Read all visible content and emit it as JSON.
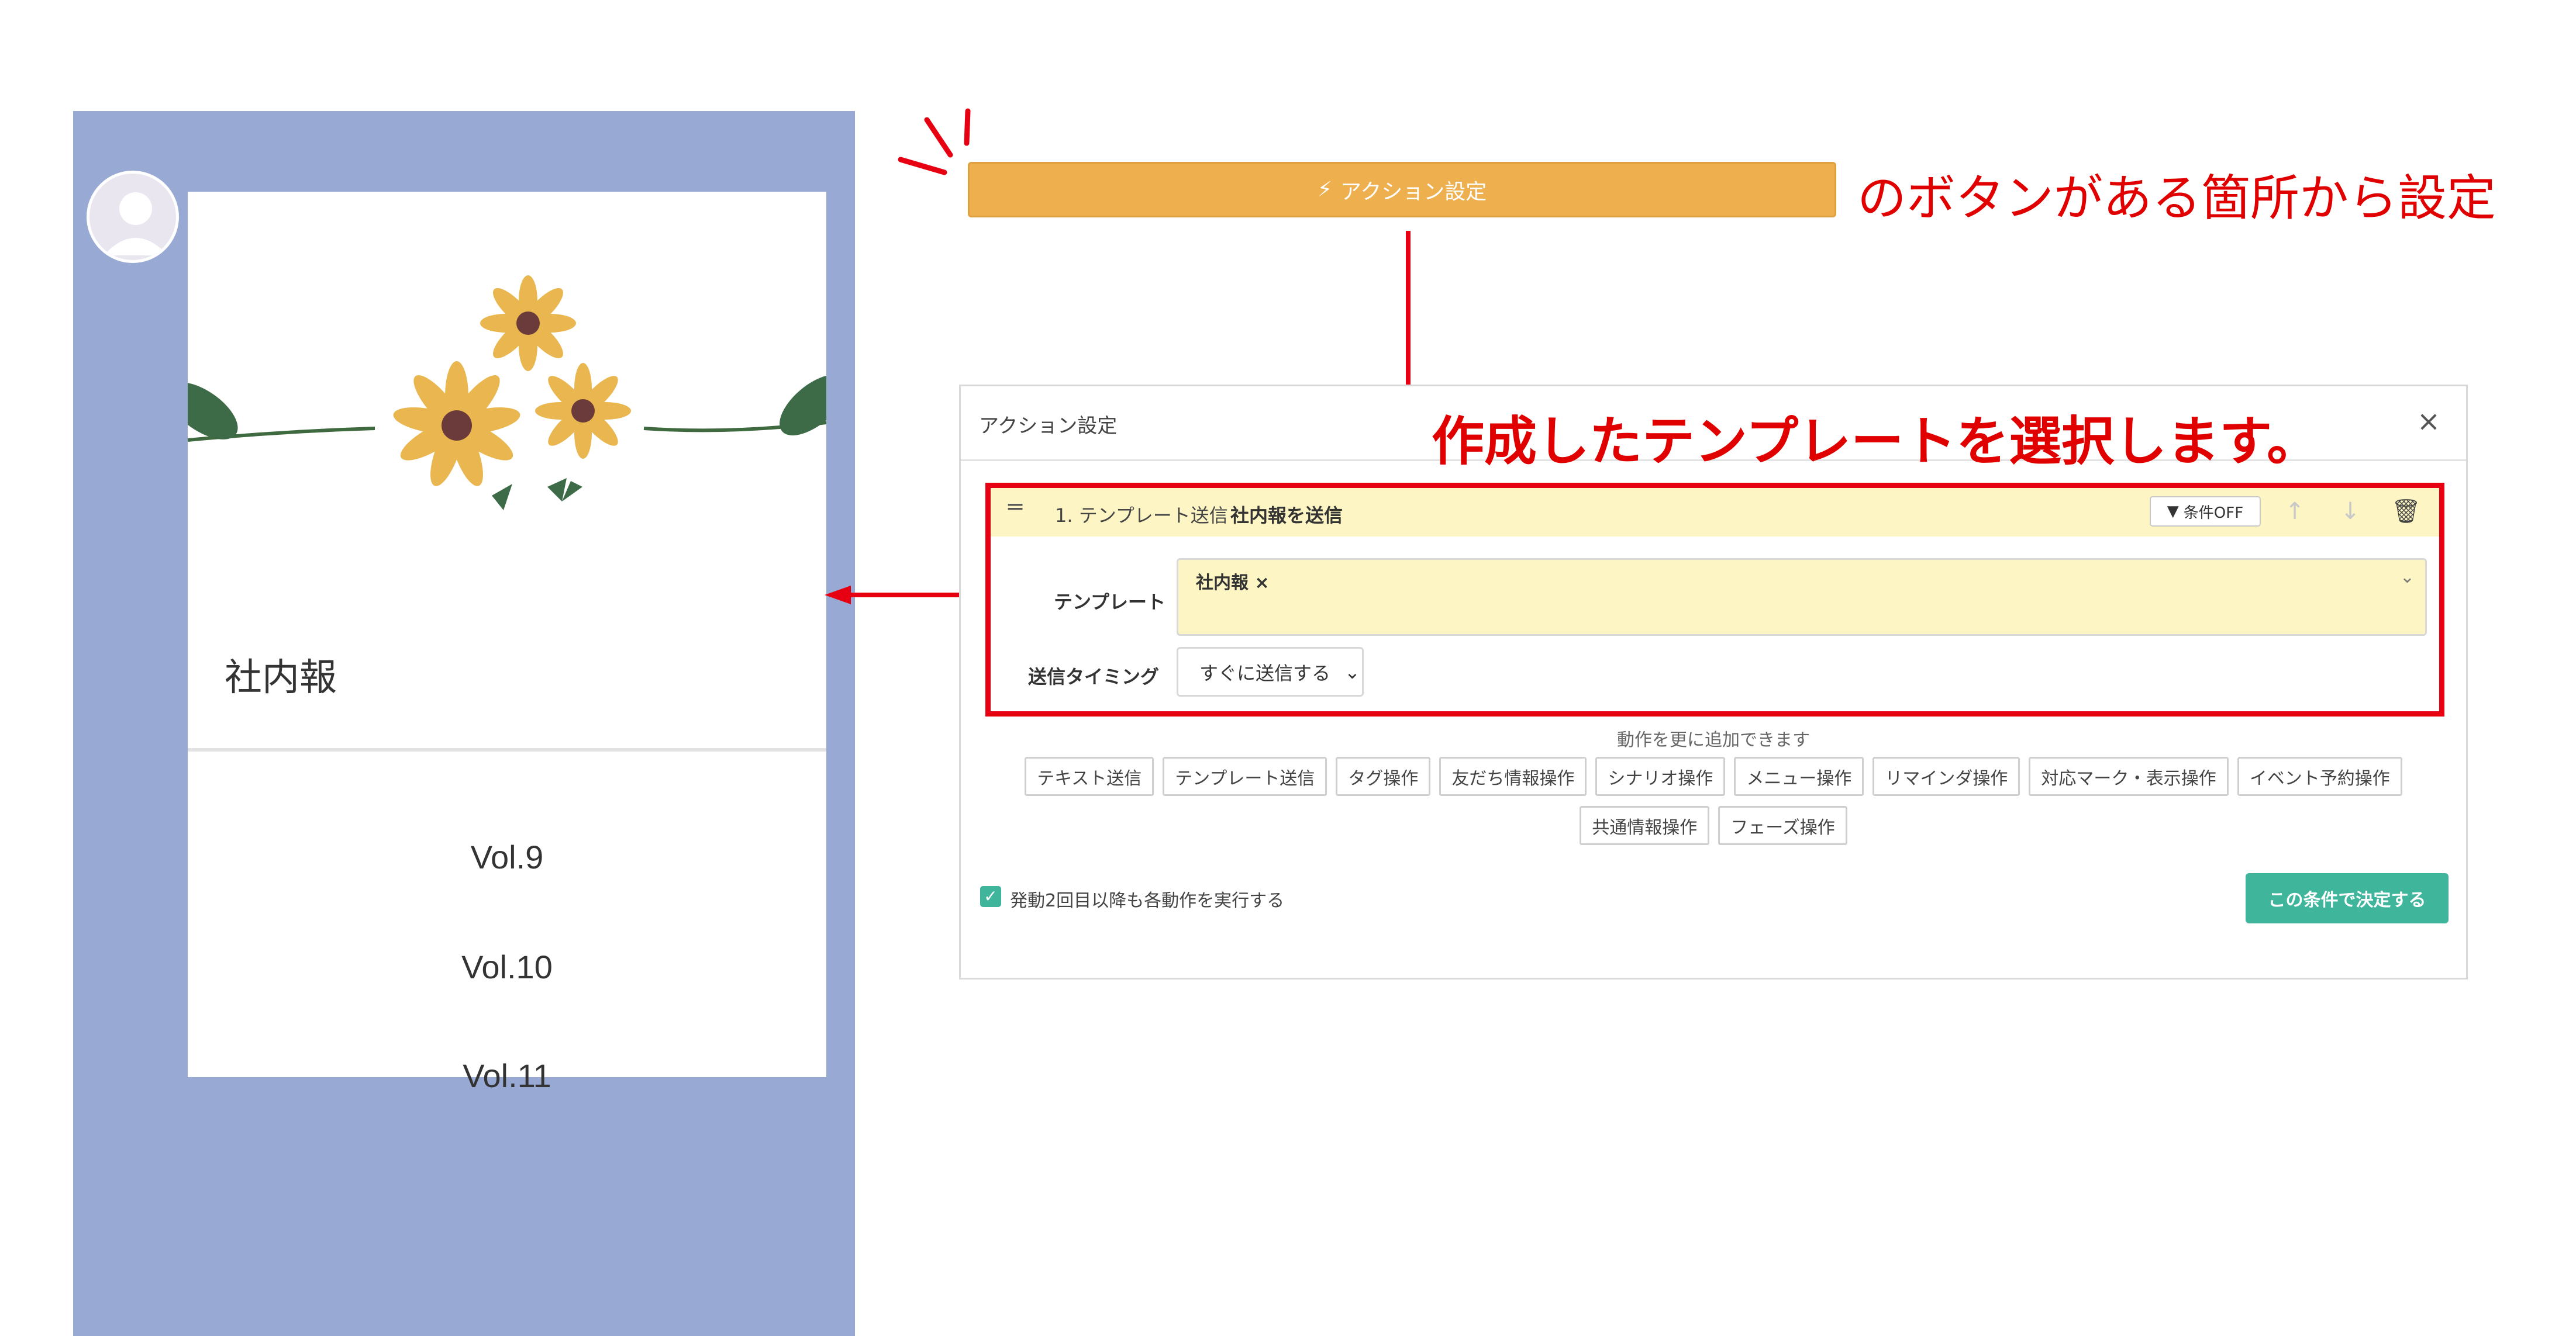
{
  "phone_preview": {
    "card": {
      "title": "社内報",
      "items": [
        "Vol.9",
        "Vol.10",
        "Vol.11"
      ]
    }
  },
  "action_button": {
    "icon": "lightning-icon",
    "label": "アクション設定",
    "color": "#eeaf4f"
  },
  "annotations": {
    "button_note": "のボタンがある箇所から設定",
    "select_note": "作成したテンプレートを選択します。",
    "color": "#e00000"
  },
  "dialog": {
    "title": "アクション設定",
    "close_icon": "close-icon",
    "action_item": {
      "step_label": "1. テンプレート送信",
      "step_name": "社内報を送信",
      "condition_button": "条件OFF",
      "template_label": "テンプレート",
      "template_value": "社内報",
      "timing_label": "送信タイミング",
      "timing_value": "すぐに送信する"
    },
    "add_note": "動作を更に追加できます",
    "action_types_row1": [
      "テキスト送信",
      "テンプレート送信",
      "タグ操作",
      "友だち情報操作",
      "シナリオ操作",
      "メニュー操作",
      "リマインダ操作",
      "対応マーク・表示操作",
      "イベント予約操作"
    ],
    "action_types_row2": [
      "共通情報操作",
      "フェーズ操作"
    ],
    "repeat_checkbox": {
      "label": "発動2回目以降も各動作を実行する",
      "checked": true
    },
    "submit_label": "この条件で決定する",
    "accent_color": "#3fb59b"
  }
}
